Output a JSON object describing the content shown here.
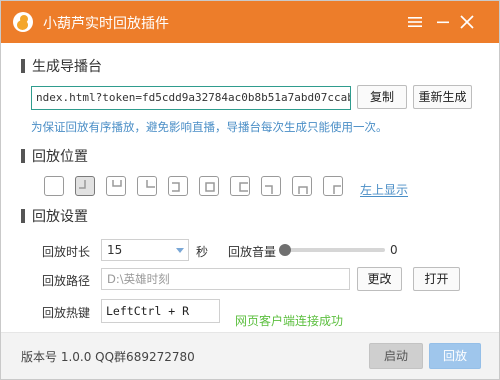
{
  "window": {
    "title": "小葫芦实时回放插件",
    "accent_color": "#ed7d2a",
    "controls": [
      "menu-icon",
      "minimize-icon",
      "close-icon"
    ]
  },
  "guide": {
    "section_title": "生成导播台",
    "url": "ndex.html?token=fd5cdd9a32784ac0b8b51a7abd07ccab",
    "copy_label": "复制",
    "regenerate_label": "重新生成",
    "hint": "为保证回放有序播放，避免影响直播，导播台每次生成只能使用一次。"
  },
  "position": {
    "section_title": "回放位置",
    "options": [
      {
        "icon": "pos-empty-icon",
        "selected": false
      },
      {
        "icon": "pos-top-left-icon",
        "selected": true
      },
      {
        "icon": "pos-top-center-icon",
        "selected": false
      },
      {
        "icon": "pos-top-right-icon",
        "selected": false
      },
      {
        "icon": "pos-middle-left-icon",
        "selected": false
      },
      {
        "icon": "pos-center-icon",
        "selected": false
      },
      {
        "icon": "pos-middle-right-icon",
        "selected": false
      },
      {
        "icon": "pos-bottom-left-icon",
        "selected": false
      },
      {
        "icon": "pos-bottom-center-icon",
        "selected": false
      },
      {
        "icon": "pos-bottom-right-icon",
        "selected": false
      }
    ],
    "selected_label": "左上显示"
  },
  "settings": {
    "section_title": "回放设置",
    "duration_label": "回放时长",
    "duration_value": "15",
    "duration_unit": "秒",
    "volume_label": "回放音量",
    "volume_value": "0",
    "path_label": "回放路径",
    "path_value": "D:\\英雄时刻",
    "change_label": "更改",
    "open_label": "打开",
    "hotkey_label": "回放热键",
    "hotkey_value": "LeftCtrl + R",
    "status_text": "网页客户端连接成功",
    "status_color": "#5cbf3f"
  },
  "footer": {
    "version_text": "版本号 1.0.0   QQ群689272780",
    "start_label": "启动",
    "replay_label": "回放"
  }
}
